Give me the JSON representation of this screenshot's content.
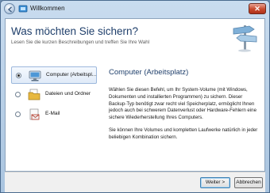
{
  "window": {
    "title": "Willkommen",
    "close_label": "✕"
  },
  "page": {
    "heading": "Was möchten Sie sichern?",
    "subtitle": "Lesen Sie die kurzen Beschreibungen und treffen Sie Ihre Wahl"
  },
  "options": [
    {
      "label": "Computer (Arbeitspl...",
      "icon": "computer-icon",
      "selected": true
    },
    {
      "label": "Dateien und Ordner",
      "icon": "folder-icon",
      "selected": false
    },
    {
      "label": "E-Mail",
      "icon": "email-icon",
      "selected": false
    }
  ],
  "detail": {
    "title": "Computer (Arbeitsplatz)",
    "paragraph1": "Wählen Sie diesen Befehl, um Ihr System-Volume (mit Windows, Dokumenten und installierten Programmen) zu sichern. Dieser Backup-Typ benötigt zwar recht viel Speicherplatz, ermöglicht Ihnen jedoch auch bei schwerem Datenverlust oder Hardware-Fehlern eine sichere Wiederherstellung Ihres Computers.",
    "paragraph2": "Sie können Ihre Volumes und kompletten Laufwerke natürlich in jeder beliebigen Kombination sichern."
  },
  "footer": {
    "next_label": "Weiter >",
    "cancel_label": "Abbrechen"
  },
  "colors": {
    "heading": "#1f3f6b",
    "selection": "#dfeaf8",
    "close": "#c8492c"
  }
}
